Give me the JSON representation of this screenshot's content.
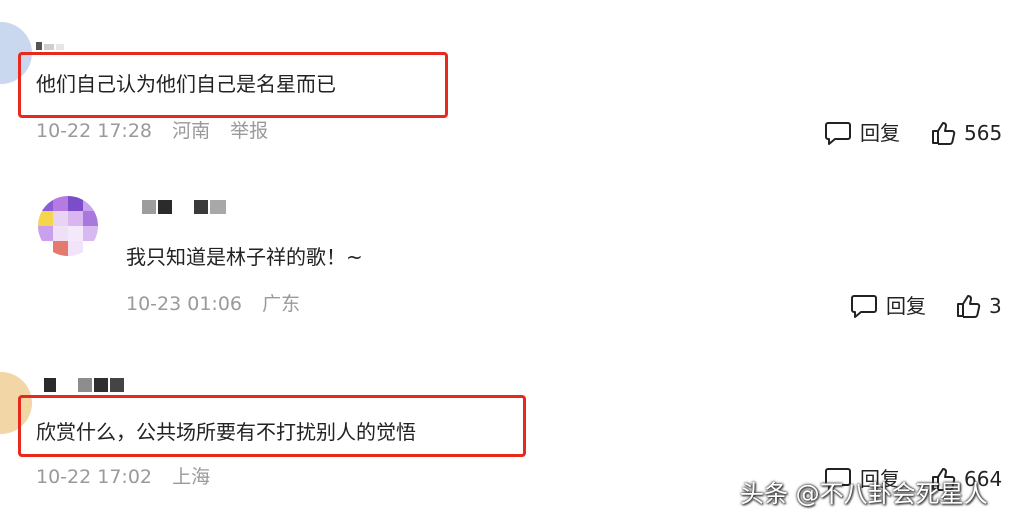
{
  "comments": [
    {
      "text": "他们自己认为他们自己是名星而已",
      "date": "10-22 17:28",
      "location": "河南",
      "report": "举报",
      "reply_label": "回复",
      "likes": "565"
    },
    {
      "text": "我只知道是林子祥的歌！~",
      "date": "10-23 01:06",
      "location": "广东",
      "reply_label": "回复",
      "likes": "3"
    },
    {
      "text": "欣赏什么，公共场所要有不打扰别人的觉悟",
      "date": "10-22 17:02",
      "location": "上海",
      "reply_label": "回复",
      "likes": "664"
    }
  ],
  "watermark": "头条 @不八卦会死星人",
  "colors": {
    "highlight": "#e8291e",
    "meta_text": "#9a9a9a",
    "body_text": "#222222"
  },
  "icons": [
    "reply-bubble-icon",
    "thumbs-up-icon"
  ]
}
